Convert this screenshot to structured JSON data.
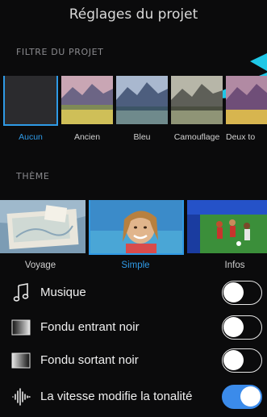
{
  "header": {
    "title": "Réglages du projet"
  },
  "filters_section": {
    "label": "FILTRE DU PROJET",
    "items": [
      {
        "name": "Aucun",
        "selected": true
      },
      {
        "name": "Ancien",
        "selected": false
      },
      {
        "name": "Bleu",
        "selected": false
      },
      {
        "name": "Camouflage",
        "selected": false
      },
      {
        "name": "Deux to",
        "selected": false
      }
    ]
  },
  "themes_section": {
    "label": "THÈME",
    "items": [
      {
        "name": "Voyage",
        "selected": false
      },
      {
        "name": "Simple",
        "selected": true
      },
      {
        "name": "Infos",
        "selected": false
      }
    ]
  },
  "settings": [
    {
      "label": "Musique",
      "icon": "music-note-icon",
      "on": false
    },
    {
      "label": "Fondu entrant noir",
      "icon": "fade-in-icon",
      "on": false
    },
    {
      "label": "Fondu sortant noir",
      "icon": "fade-out-icon",
      "on": false
    },
    {
      "label": "La vitesse modifie la tonalité",
      "icon": "waveform-icon",
      "on": true
    }
  ],
  "colors": {
    "accent": "#2f9ae6",
    "toggle_on": "#3b8bea",
    "annotation_arrow": "#1fc7e6"
  }
}
